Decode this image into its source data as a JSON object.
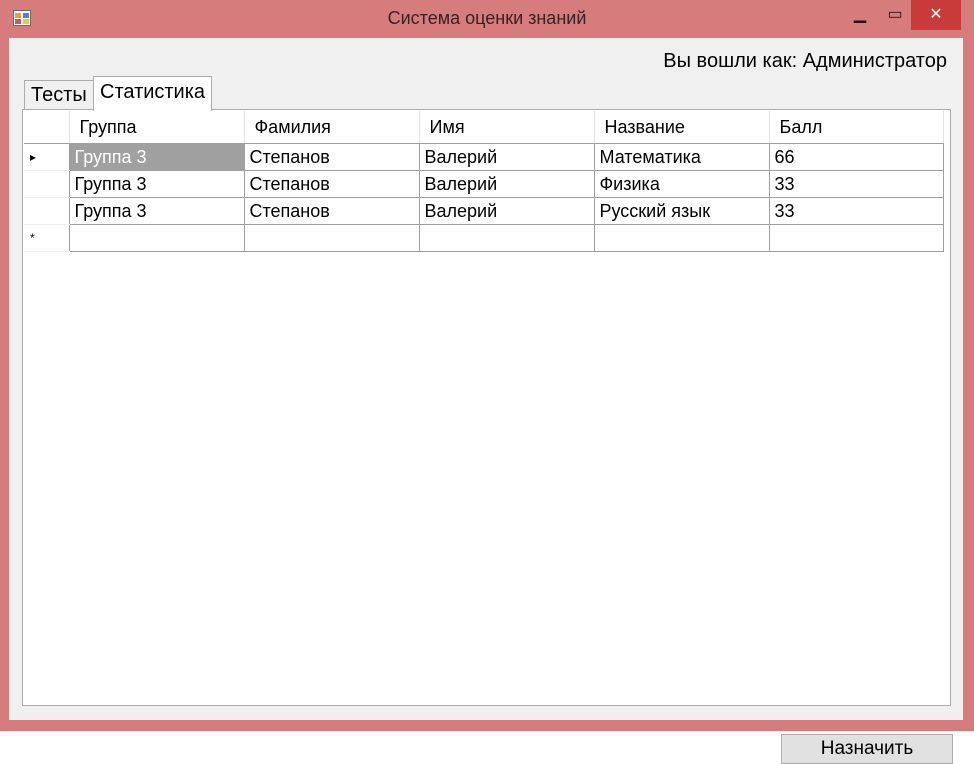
{
  "window": {
    "title": "Система оценки знаний",
    "controls": {
      "minimize": "▁",
      "maximize": "▭",
      "close": "✕"
    },
    "frame_color": "#d67c7c",
    "close_color": "#c93b3b"
  },
  "header": {
    "user_label": "Вы вошли как: Администратор"
  },
  "tabs": [
    {
      "label": "Тесты",
      "active": false
    },
    {
      "label": "Статистика",
      "active": true
    }
  ],
  "grid": {
    "columns": [
      "Группа",
      "Фамилия",
      "Имя",
      "Название",
      "Балл"
    ],
    "rows": [
      {
        "indicator": "▸",
        "cells": [
          "Группа 3",
          "Степанов",
          "Валерий",
          "Математика",
          "66"
        ]
      },
      {
        "indicator": "",
        "cells": [
          "Группа 3",
          "Степанов",
          "Валерий",
          "Физика",
          "33"
        ]
      },
      {
        "indicator": "",
        "cells": [
          "Группа 3",
          "Степанов",
          "Валерий",
          "Русский язык",
          "33"
        ]
      }
    ],
    "new_row_indicator": "*"
  },
  "actions": {
    "assign_label": "Назначить"
  }
}
